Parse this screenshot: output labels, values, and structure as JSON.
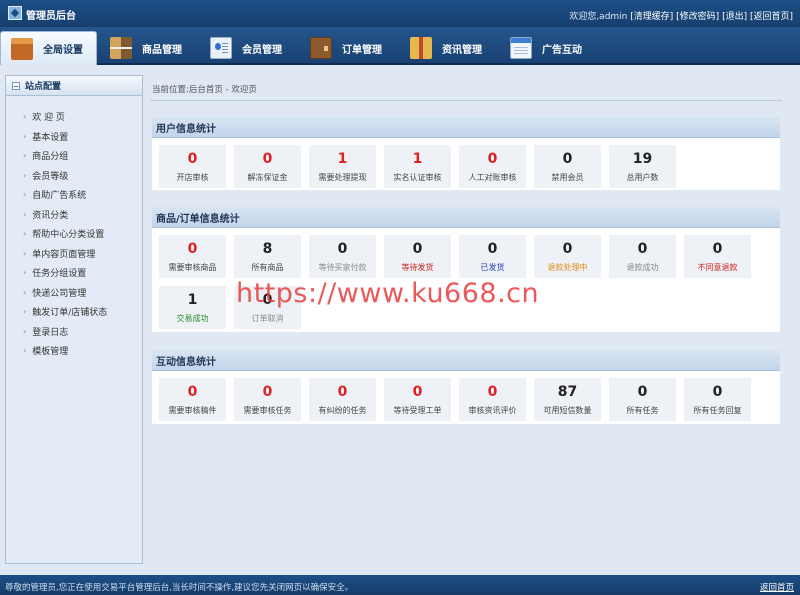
{
  "header": {
    "title": "管理员后台",
    "welcome": "欢迎您,admin",
    "links": [
      "[清理缓存]",
      "[修改密码]",
      "[退出]",
      "[返回首页]"
    ]
  },
  "nav": {
    "tabs": [
      {
        "label": "全局设置",
        "icon": "home-icon",
        "active": true
      },
      {
        "label": "商品管理",
        "icon": "goods-icon"
      },
      {
        "label": "会员管理",
        "icon": "member-card-icon"
      },
      {
        "label": "订单管理",
        "icon": "order-wallet-icon"
      },
      {
        "label": "资讯管理",
        "icon": "news-book-icon"
      },
      {
        "label": "广告互动",
        "icon": "ad-window-icon"
      }
    ]
  },
  "sidebar": {
    "title": "站点配置",
    "items": [
      "欢 迎 页",
      "基本设置",
      "商品分组",
      "会员等级",
      "自助广告系统",
      "资讯分类",
      "帮助中心分类设置",
      "单内容页面管理",
      "任务分组设置",
      "快递公司管理",
      "触发订单/店铺状态",
      "登录日志",
      "模板管理"
    ]
  },
  "breadcrumb": "当前位置:后台首页 - 欢迎页",
  "panels": [
    {
      "title": "用户信息统计",
      "stats": [
        {
          "value": "0",
          "label": "开店审核",
          "value_color": "#e02020",
          "label_color": "#444444"
        },
        {
          "value": "0",
          "label": "解冻保证金",
          "value_color": "#e02020",
          "label_color": "#444444"
        },
        {
          "value": "1",
          "label": "需要处理提现",
          "value_color": "#e02020",
          "label_color": "#444444"
        },
        {
          "value": "1",
          "label": "实名认证审核",
          "value_color": "#e02020",
          "label_color": "#444444"
        },
        {
          "value": "0",
          "label": "人工对账审核",
          "value_color": "#e02020",
          "label_color": "#444444"
        },
        {
          "value": "0",
          "label": "禁用会员",
          "value_color": "#222222",
          "label_color": "#444444"
        },
        {
          "value": "19",
          "label": "总用户数",
          "value_color": "#222222",
          "label_color": "#444444"
        }
      ]
    },
    {
      "title": "商品/订单信息统计",
      "stats": [
        {
          "value": "0",
          "label": "需要审核商品",
          "value_color": "#e02020",
          "label_color": "#444444"
        },
        {
          "value": "8",
          "label": "所有商品",
          "value_color": "#222222",
          "label_color": "#444444"
        },
        {
          "value": "0",
          "label": "等待买家付款",
          "value_color": "#222222",
          "label_color": "#888888"
        },
        {
          "value": "0",
          "label": "等待发货",
          "value_color": "#222222",
          "label_color": "#d02020"
        },
        {
          "value": "0",
          "label": "已发货",
          "value_color": "#222222",
          "label_color": "#2a40b8"
        },
        {
          "value": "0",
          "label": "退款处理中",
          "value_color": "#222222",
          "label_color": "#e08a10"
        },
        {
          "value": "0",
          "label": "退款成功",
          "value_color": "#222222",
          "label_color": "#888888"
        },
        {
          "value": "0",
          "label": "不同意退款",
          "value_color": "#222222",
          "label_color": "#d02020"
        },
        {
          "value": "1",
          "label": "交易成功",
          "value_color": "#222222",
          "label_color": "#2a8a2a"
        },
        {
          "value": "0",
          "label": "订单取消",
          "value_color": "#222222",
          "label_color": "#888888"
        }
      ]
    },
    {
      "title": "互动信息统计",
      "stats": [
        {
          "value": "0",
          "label": "需要审核稿件",
          "value_color": "#e02020",
          "label_color": "#444444"
        },
        {
          "value": "0",
          "label": "需要审核任务",
          "value_color": "#e02020",
          "label_color": "#444444"
        },
        {
          "value": "0",
          "label": "有纠纷的任务",
          "value_color": "#e02020",
          "label_color": "#444444"
        },
        {
          "value": "0",
          "label": "等待受理工单",
          "value_color": "#e02020",
          "label_color": "#444444"
        },
        {
          "value": "0",
          "label": "审核资讯评价",
          "value_color": "#e02020",
          "label_color": "#444444"
        },
        {
          "value": "87",
          "label": "可用短信数量",
          "value_color": "#222222",
          "label_color": "#444444"
        },
        {
          "value": "0",
          "label": "所有任务",
          "value_color": "#222222",
          "label_color": "#444444"
        },
        {
          "value": "0",
          "label": "所有任务回复",
          "value_color": "#222222",
          "label_color": "#444444"
        }
      ]
    }
  ],
  "footer": {
    "note": "尊敬的管理员,您正在使用交易平台管理后台,当长时间不操作,建议您先关闭网页以确保安全。",
    "home_link": "返回首页"
  },
  "watermark": "https://www.ku668.cn"
}
